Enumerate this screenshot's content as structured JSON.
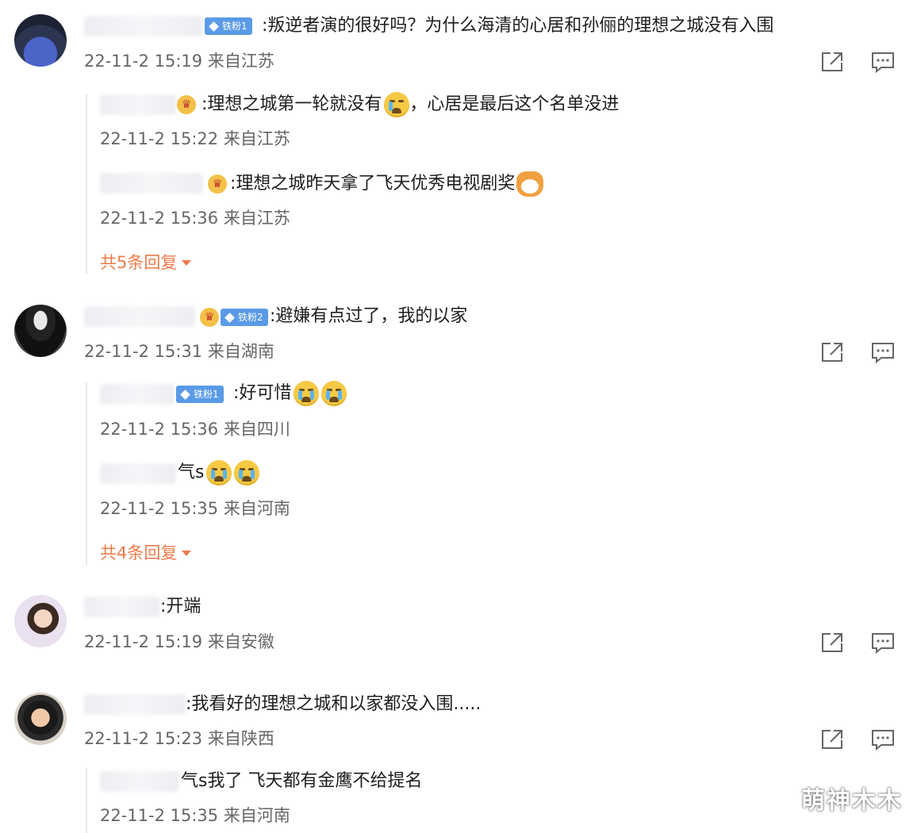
{
  "comments": [
    {
      "badge": "铁粉1",
      "text": ":叛逆者演的很好吗？为什么海清的心居和孙俪的理想之城没有入围",
      "meta": "22-11-2 15:19 来自江苏",
      "replies": [
        {
          "text": ":理想之城第一轮就没有",
          "text_after": "，心居是最后这个名单没进",
          "meta": "22-11-2 15:22 来自江苏"
        },
        {
          "text": ":理想之城昨天拿了飞天优秀电视剧奖",
          "meta": "22-11-2 15:36 来自江苏"
        }
      ],
      "more": "共5条回复"
    },
    {
      "badge": "铁粉2",
      "text": ":避嫌有点过了，我的以家",
      "meta": "22-11-2 15:31 来自湖南",
      "replies": [
        {
          "badge": "铁粉1",
          "text": ":好可惜",
          "meta": "22-11-2 15:36 来自四川"
        },
        {
          "text": "气s",
          "meta": "22-11-2 15:35 来自河南"
        }
      ],
      "more": "共4条回复"
    },
    {
      "text": ":开端",
      "meta": "22-11-2 15:19 来自安徽"
    },
    {
      "text": ":我看好的理想之城和以家都没入围.....",
      "meta": "22-11-2 15:23 来自陕西",
      "replies": [
        {
          "text": "气s我了 飞天都有金鹰不给提名",
          "meta": "22-11-2 15:35 来自河南"
        }
      ]
    }
  ],
  "icons": {
    "share": "share-icon",
    "comment": "comment-icon"
  },
  "colors": {
    "badge": "#5a9ae6",
    "more_link": "#ee7b4b",
    "meta": "#666666"
  },
  "watermark": "萌神木木"
}
